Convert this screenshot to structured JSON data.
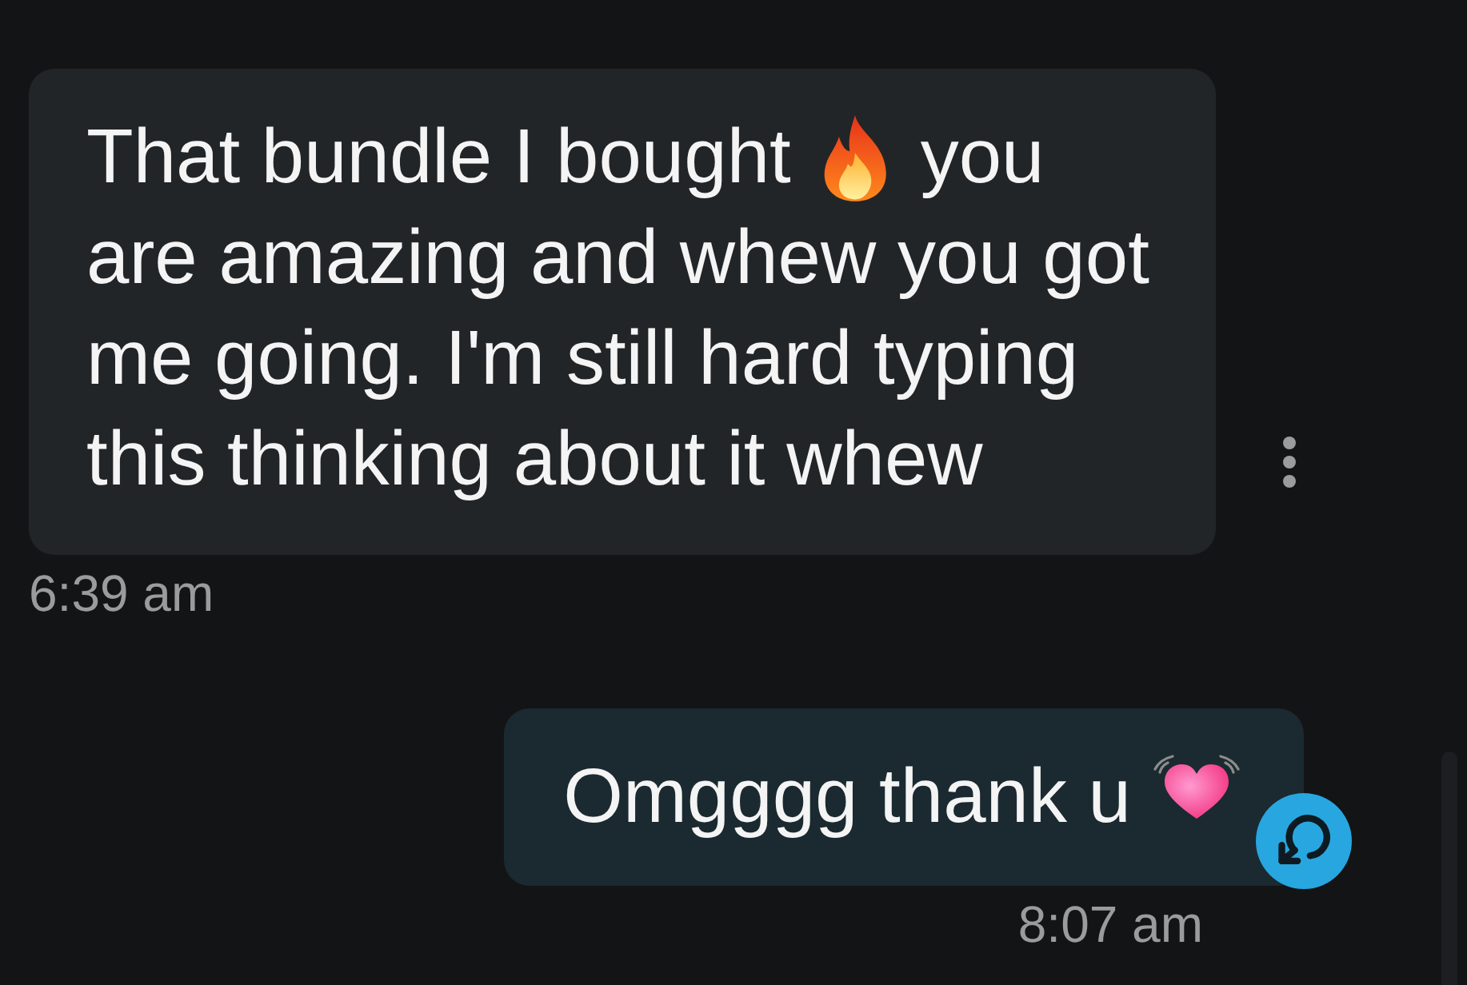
{
  "messages": [
    {
      "kind": "received",
      "lines": [
        [
          {
            "kind": "text",
            "text": "That bundle I bought"
          },
          {
            "kind": "fire"
          },
          {
            "kind": "text",
            "text": "you"
          }
        ],
        [
          {
            "kind": "text",
            "text": "are amazing and whew you got"
          }
        ],
        [
          {
            "kind": "text",
            "text": "me going. I'm still hard typing"
          }
        ],
        [
          {
            "kind": "text",
            "text": "this thinking about it whew"
          }
        ]
      ],
      "time": "6:39 am"
    },
    {
      "kind": "sent",
      "lines": [
        [
          {
            "kind": "text",
            "text": "Omgggg thank u"
          },
          {
            "kind": "heart"
          }
        ]
      ],
      "time": "8:07 am"
    }
  ]
}
